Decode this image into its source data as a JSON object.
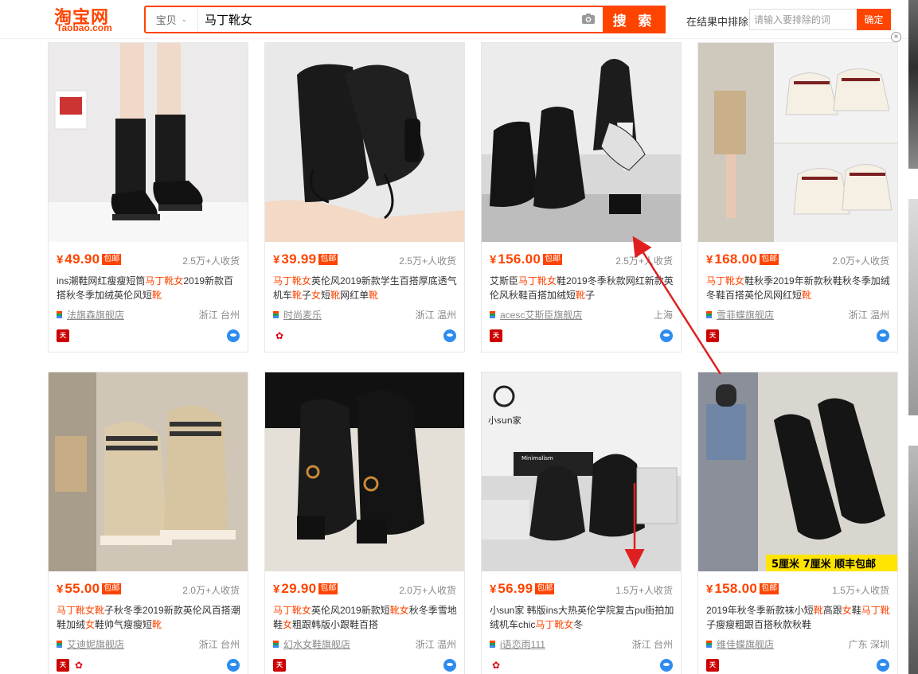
{
  "header": {
    "logo_cn": "淘宝网",
    "logo_en": "Taobao.com",
    "search_scope": "宝贝",
    "search_query": "马丁靴女",
    "search_button": "搜 索",
    "exclude_label": "在结果中排除",
    "exclude_placeholder": "请输入要排除的词",
    "exclude_button": "确定"
  },
  "colors": {
    "accent": "#ff4400",
    "tmall_red": "#cc0000",
    "wangwang_blue": "#2d8cf0"
  },
  "products": [
    {
      "price_symbol": "¥",
      "price": "49.90",
      "tag": "包邮",
      "sales": "2.5万+人收货",
      "title_parts": [
        {
          "t": "ins潮鞋网红瘦瘦短筒"
        },
        {
          "t": "马丁靴女",
          "hl": true
        },
        {
          "t": "2019新款百搭秋冬季加绒英伦风短"
        },
        {
          "t": "靴",
          "hl": true
        }
      ],
      "shop": "法旗森旗舰店",
      "location": "浙江 台州",
      "badges": [
        "tmall"
      ]
    },
    {
      "price_symbol": "¥",
      "price": "39.99",
      "tag": "包邮",
      "sales": "2.5万+人收货",
      "title_parts": [
        {
          "t": "马丁靴女",
          "hl": true
        },
        {
          "t": "英伦风2019新款学生百搭厚底透气机车"
        },
        {
          "t": "靴",
          "hl": true
        },
        {
          "t": "子"
        },
        {
          "t": "女",
          "hl": true
        },
        {
          "t": "短"
        },
        {
          "t": "靴",
          "hl": true
        },
        {
          "t": "网红单"
        },
        {
          "t": "靴",
          "hl": true
        }
      ],
      "shop": "时尚麦乐",
      "location": "浙江 温州",
      "badges": [
        "rose"
      ]
    },
    {
      "price_symbol": "¥",
      "price": "156.00",
      "tag": "包邮",
      "sales": "2.5万+人收货",
      "title_parts": [
        {
          "t": "艾斯臣"
        },
        {
          "t": "马丁靴女",
          "hl": true
        },
        {
          "t": "鞋2019冬季秋款网红新款英伦风秋鞋百搭加绒短"
        },
        {
          "t": "靴",
          "hl": true
        },
        {
          "t": "子"
        }
      ],
      "shop": "acesc艾斯臣旗舰店",
      "location": "上海",
      "badges": [
        "tmall"
      ]
    },
    {
      "price_symbol": "¥",
      "price": "168.00",
      "tag": "包邮",
      "sales": "2.0万+人收货",
      "title_parts": [
        {
          "t": "马丁靴女",
          "hl": true
        },
        {
          "t": "鞋秋季2019年新款秋鞋秋冬季加绒冬鞋百搭英伦风网红短"
        },
        {
          "t": "靴",
          "hl": true
        }
      ],
      "shop": "雪菲蝶旗舰店",
      "location": "浙江 温州",
      "badges": [
        "tmall"
      ]
    },
    {
      "price_symbol": "¥",
      "price": "55.00",
      "tag": "包邮",
      "sales": "2.0万+人收货",
      "title_parts": [
        {
          "t": "马丁靴女靴",
          "hl": true
        },
        {
          "t": "子秋冬季2019新款英伦风百搭潮鞋加绒"
        },
        {
          "t": "女",
          "hl": true
        },
        {
          "t": "鞋帅气瘦瘦短"
        },
        {
          "t": "靴",
          "hl": true
        }
      ],
      "shop": "艾迪妮旗舰店",
      "location": "浙江 台州",
      "badges": [
        "tmall",
        "rose"
      ]
    },
    {
      "price_symbol": "¥",
      "price": "29.90",
      "tag": "包邮",
      "sales": "2.0万+人收货",
      "title_parts": [
        {
          "t": "马丁靴女",
          "hl": true
        },
        {
          "t": "英伦风2019新款短"
        },
        {
          "t": "靴女",
          "hl": true
        },
        {
          "t": "秋冬季雪地鞋"
        },
        {
          "t": "女",
          "hl": true
        },
        {
          "t": "粗跟韩版小跟鞋百搭"
        }
      ],
      "shop": "幻水女鞋旗舰店",
      "location": "浙江 温州",
      "badges": [
        "tmall"
      ]
    },
    {
      "price_symbol": "¥",
      "price": "56.99",
      "tag": "包邮",
      "sales": "1.5万+人收货",
      "title_parts": [
        {
          "t": "小sun家 韩版ins大热英伦学院复古pu街拍加绒机车chic"
        },
        {
          "t": "马丁靴女",
          "hl": true
        },
        {
          "t": "冬"
        }
      ],
      "shop": "i语恋雨111",
      "location": "浙江 台州",
      "badges": [
        "rose"
      ]
    },
    {
      "price_symbol": "¥",
      "price": "158.00",
      "tag": "包邮",
      "sales": "1.5万+人收货",
      "title_parts": [
        {
          "t": "2019年秋冬季新款袜小短"
        },
        {
          "t": "靴",
          "hl": true
        },
        {
          "t": "高跟"
        },
        {
          "t": "女",
          "hl": true
        },
        {
          "t": "鞋"
        },
        {
          "t": "马丁靴",
          "hl": true
        },
        {
          "t": "子瘦瘦粗跟百搭秋款秋鞋"
        }
      ],
      "shop": "维佳蝶旗舰店",
      "location": "广东 深圳",
      "badges": [
        "tmall"
      ]
    }
  ],
  "image_overlays": {
    "p7_brand": "小sun家",
    "p7_box": "Minimalism",
    "p8_banner": "5厘米 7厘米 顺丰包邮"
  }
}
